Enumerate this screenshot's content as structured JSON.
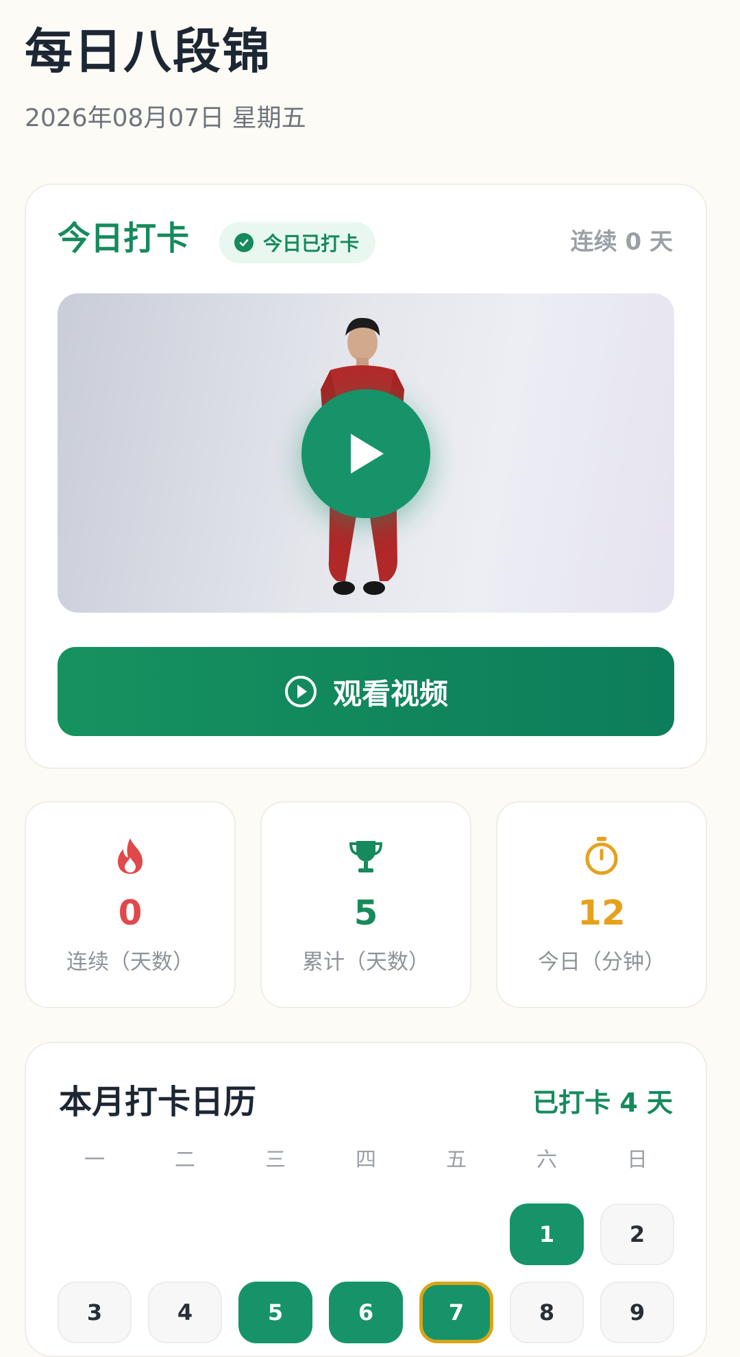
{
  "header": {
    "title": "每日八段锦",
    "date": "2026年08月07日 星期五"
  },
  "checkin": {
    "title": "今日打卡",
    "badge": "今日已打卡",
    "streak": "连续 0 天",
    "video": {
      "play_icon": "play-icon"
    },
    "watch_button": "观看视频"
  },
  "stats": [
    {
      "icon": "flame-icon",
      "value": "0",
      "label": "连续（天数）",
      "color": "#e0484a"
    },
    {
      "icon": "trophy-icon",
      "value": "5",
      "label": "累计（天数）",
      "color": "#168a5c"
    },
    {
      "icon": "stopwatch-icon",
      "value": "12",
      "label": "今日（分钟）",
      "color": "#e6a11c"
    }
  ],
  "calendar": {
    "title": "本月打卡日历",
    "summary": "已打卡 4 天",
    "weekdays": [
      "一",
      "二",
      "三",
      "四",
      "五",
      "六",
      "日"
    ],
    "days": [
      {
        "label": "1",
        "status": "done"
      },
      {
        "label": "2",
        "status": "none"
      },
      {
        "label": "3",
        "status": "none"
      },
      {
        "label": "4",
        "status": "none"
      },
      {
        "label": "5",
        "status": "done"
      },
      {
        "label": "6",
        "status": "done"
      },
      {
        "label": "7",
        "status": "done",
        "today": true
      },
      {
        "label": "8",
        "status": "none"
      },
      {
        "label": "9",
        "status": "none"
      }
    ]
  },
  "colors": {
    "accent": "#168a5c",
    "today_ring": "#d9a516",
    "background": "#fcfbf6"
  }
}
